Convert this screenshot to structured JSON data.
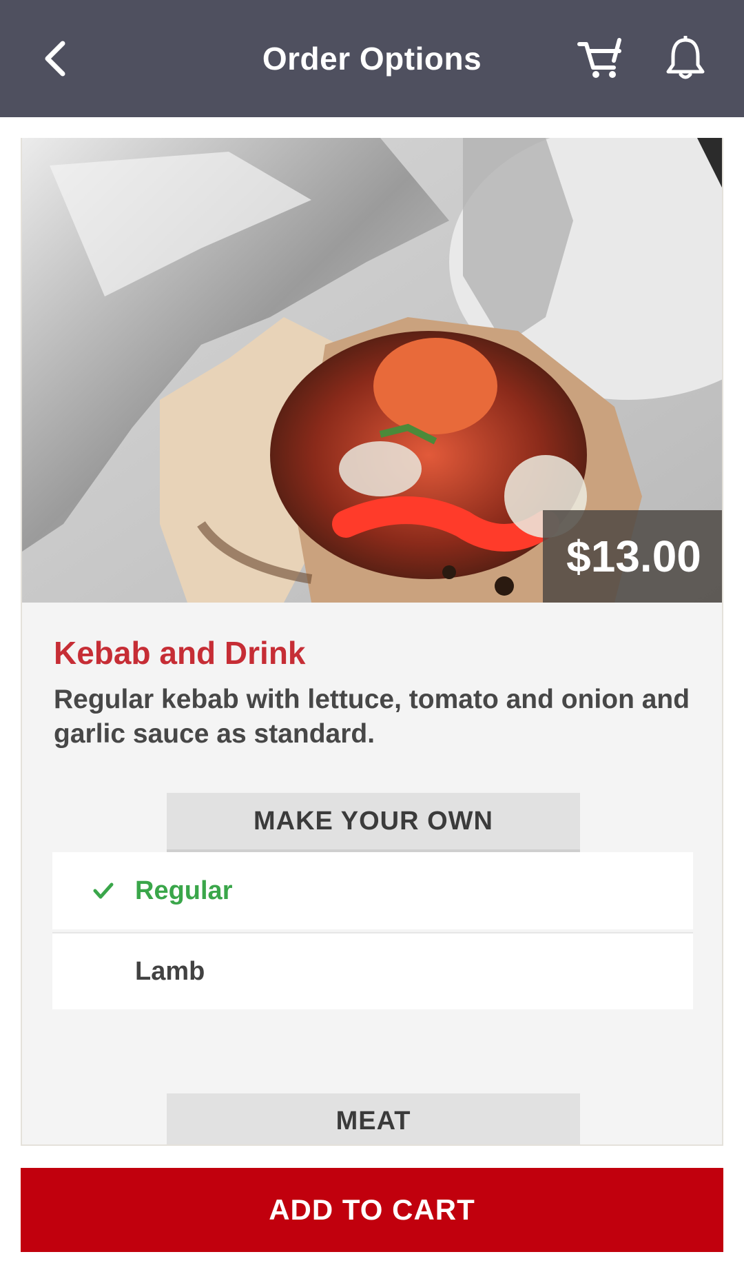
{
  "header": {
    "title": "Order Options",
    "back_icon": "chevron-left-icon",
    "cart_icon": "cart-icon",
    "notifications_icon": "bell-icon",
    "background_color": "#4f505f"
  },
  "item": {
    "image_alt": "Kebab wrapped in foil",
    "price": "$13.00",
    "title": "Kebab and Drink",
    "description": "Regular kebab with lettuce, tomato and onion and garlic sauce as standard."
  },
  "sections": [
    {
      "title": "MAKE YOUR OWN",
      "options": [
        {
          "label": "Regular",
          "selected": true
        },
        {
          "label": "Lamb",
          "selected": false
        }
      ]
    },
    {
      "title": "MEAT",
      "options": []
    }
  ],
  "actions": {
    "add_to_cart": "ADD TO CART"
  },
  "colors": {
    "title_red": "#c62d35",
    "selected_green": "#3aa64a",
    "cart_button_red": "#c1000d"
  }
}
